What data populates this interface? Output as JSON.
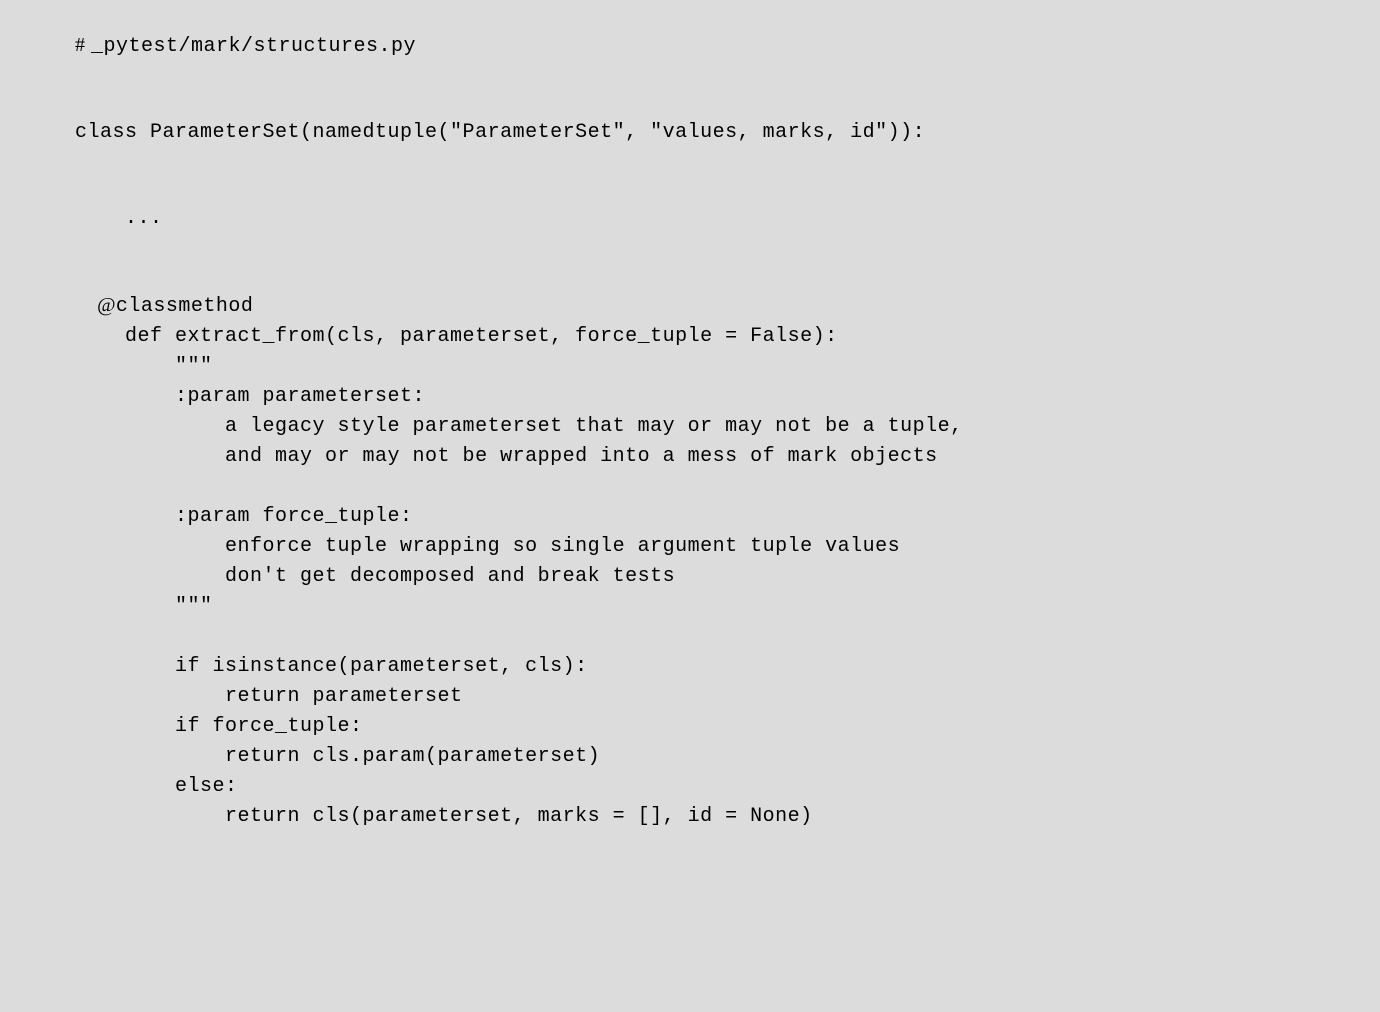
{
  "code": {
    "l1_pre": "# ",
    "l1": "_pytest/mark/structures.py",
    "l2": "class ParameterSet(namedtuple(\"ParameterSet\", \"values, marks, id\")):",
    "l3": "    ...",
    "l4_pre": "    @",
    "l4": "classmethod",
    "l5": "    def extract_from(cls, parameterset, force_tuple = False):",
    "l6": "        \"\"\"",
    "l7": "        :param parameterset:",
    "l8": "            a legacy style parameterset that may or may not be a tuple,",
    "l9": "            and may or may not be wrapped into a mess of mark objects",
    "l10": "        :param force_tuple:",
    "l11": "            enforce tuple wrapping so single argument tuple values",
    "l12": "            don't get decomposed and break tests",
    "l13": "        \"\"\"",
    "l14": "        if isinstance(parameterset, cls):",
    "l15": "            return parameterset",
    "l16": "        if force_tuple:",
    "l17": "            return cls.param(parameterset)",
    "l18": "        else:",
    "l19": "            return cls(parameterset, marks = [], id = None)"
  }
}
